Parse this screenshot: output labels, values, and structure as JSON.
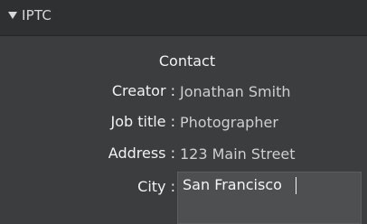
{
  "panel": {
    "title": "IPTC",
    "expanded": true
  },
  "section": {
    "heading": "Contact"
  },
  "fields": [
    {
      "label": "Creator :",
      "value": "Jonathan Smith"
    },
    {
      "label": "Job title :",
      "value": "Photographer"
    },
    {
      "label": "Address :",
      "value": "123 Main Street"
    },
    {
      "label": "City :",
      "value": "San Francisco"
    }
  ],
  "colors": {
    "panel_bg": "#3b3d3e",
    "header_bg": "#2e3031",
    "label_text": "#f2f2f2",
    "value_text": "#cfcfcf",
    "input_bg": "#4d4f50"
  }
}
